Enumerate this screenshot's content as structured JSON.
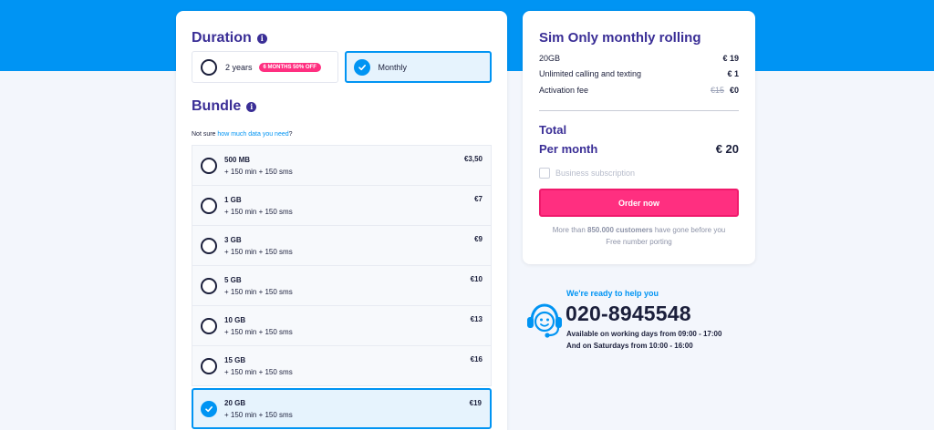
{
  "duration": {
    "title": "Duration",
    "options": [
      {
        "label": "2 years",
        "badge": "6 MONTHS 50% OFF",
        "selected": false
      },
      {
        "label": "Monthly",
        "selected": true
      }
    ]
  },
  "bundle": {
    "title": "Bundle",
    "subtitle_prefix": "Not sure ",
    "subtitle_link": "how much data you need",
    "subtitle_suffix": "?",
    "items": [
      {
        "name": "500 MB",
        "desc": "+ 150 min + 150 sms",
        "price": "€3,50",
        "selected": false
      },
      {
        "name": "1 GB",
        "desc": "+ 150 min + 150 sms",
        "price": "€7",
        "selected": false
      },
      {
        "name": "3 GB",
        "desc": "+ 150 min + 150 sms",
        "price": "€9",
        "selected": false
      },
      {
        "name": "5 GB",
        "desc": "+ 150 min + 150 sms",
        "price": "€10",
        "selected": false
      },
      {
        "name": "10 GB",
        "desc": "+ 150 min + 150 sms",
        "price": "€13",
        "selected": false
      },
      {
        "name": "15 GB",
        "desc": "+ 150 min + 150 sms",
        "price": "€16",
        "selected": false
      },
      {
        "name": "20 GB",
        "desc": "+ 150 min + 150 sms",
        "price": "€19",
        "selected": true
      }
    ]
  },
  "summary": {
    "title": "Sim Only monthly rolling",
    "lines": [
      {
        "label": "20GB",
        "value": "€ 19"
      },
      {
        "label": "Unlimited calling and texting",
        "value": "€ 1"
      },
      {
        "label": "Activation fee",
        "old_value": "€15",
        "value": "€0"
      }
    ],
    "total_label": "Total",
    "per_month_label": "Per month",
    "per_month_value": "€ 20",
    "business_label": "Business subscription",
    "order_button": "Order now",
    "foot_prefix": "More than ",
    "foot_bold": "850.000 customers",
    "foot_suffix": " have gone before you",
    "foot_line2": "Free number porting"
  },
  "help": {
    "ready": "We're ready to help you",
    "phone": "020-8945548",
    "hours_weekdays": "Available on working days from 09:00 - 17:00",
    "hours_saturday": "And on Saturdays from 10:00 - 16:00",
    "icon": "support-agent-icon"
  },
  "colors": {
    "brand_blue": "#0094f3",
    "brand_purple": "#3a2e96",
    "accent_pink": "#ff2f80"
  }
}
